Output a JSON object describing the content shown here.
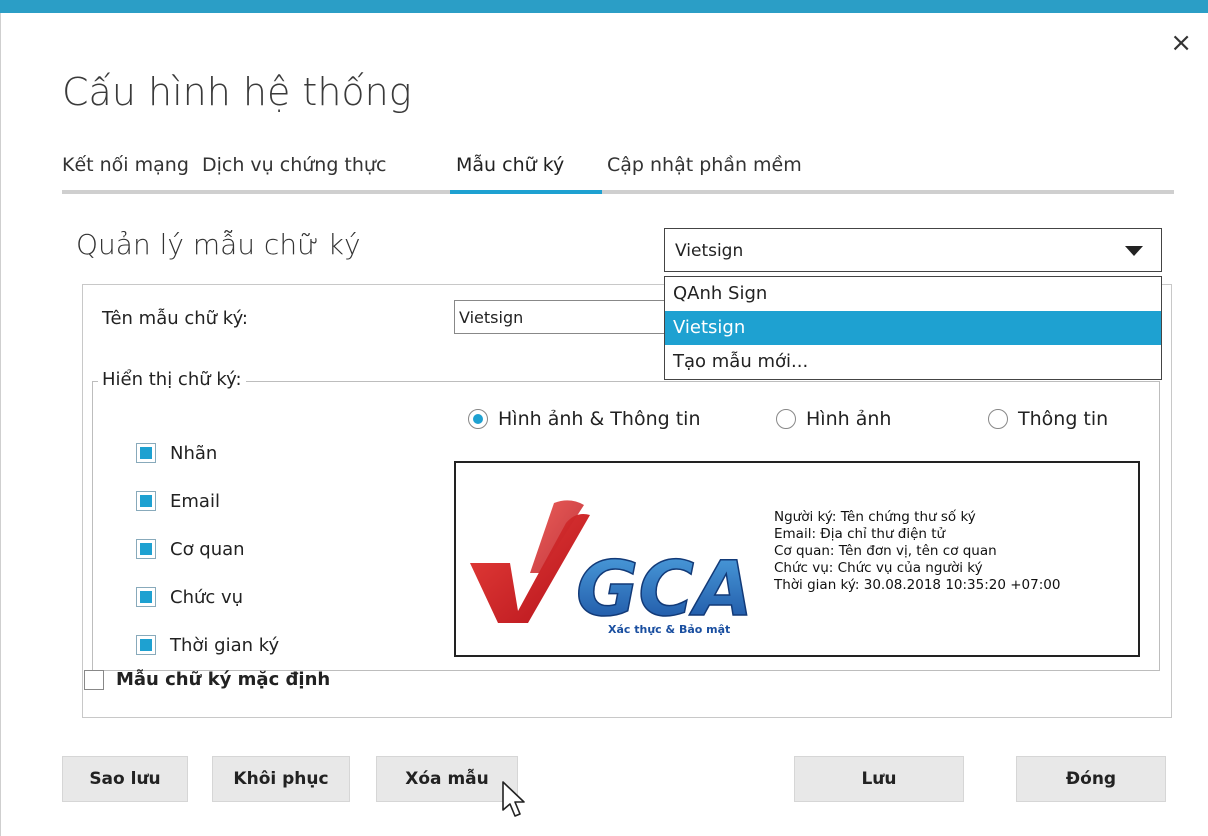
{
  "window": {
    "title": "Cấu hình hệ thống",
    "close_symbol": "×",
    "accent_color": "#1ea1d1"
  },
  "tabs": [
    {
      "label": "Kết nối mạng",
      "active": false
    },
    {
      "label": "Dịch vụ chứng thực",
      "active": false
    },
    {
      "label": "Mẫu chữ ký",
      "active": true
    },
    {
      "label": "Cập nhật phần mềm",
      "active": false
    }
  ],
  "section": {
    "title": "Quản lý mẫu chữ ký"
  },
  "template_select": {
    "value": "Vietsign",
    "options": [
      "QAnh Sign",
      "Vietsign",
      "Tạo mẫu mới..."
    ],
    "selected_index": 1
  },
  "form": {
    "name_label": "Tên mẫu chữ ký:",
    "name_value": "Vietsign",
    "display_group_label": "Hiển thị chữ ký:",
    "display_modes": [
      {
        "label": "Hình ảnh & Thông tin",
        "checked": true
      },
      {
        "label": "Hình ảnh",
        "checked": false
      },
      {
        "label": "Thông tin",
        "checked": false
      }
    ],
    "fields": [
      {
        "label": "Nhãn",
        "checked": true
      },
      {
        "label": "Email",
        "checked": true
      },
      {
        "label": "Cơ quan",
        "checked": true
      },
      {
        "label": "Chức vụ",
        "checked": true
      },
      {
        "label": "Thời gian ký",
        "checked": true
      }
    ],
    "default_label": "Mẫu chữ ký mặc định",
    "default_checked": false
  },
  "preview": {
    "logo_text": "GCA",
    "logo_tagline": "Xác thực & Bảo mật",
    "lines": [
      "Người ký: Tên chứng thư số ký",
      "Email: Địa chỉ thư điện tử",
      "Cơ quan: Tên đơn vị, tên cơ quan",
      "Chức vụ: Chức vụ của người ký",
      "Thời gian ký: 30.08.2018 10:35:20 +07:00"
    ]
  },
  "buttons": {
    "backup": "Sao lưu",
    "restore": "Khôi phục",
    "delete": "Xóa mẫu",
    "save": "Lưu",
    "close": "Đóng"
  }
}
